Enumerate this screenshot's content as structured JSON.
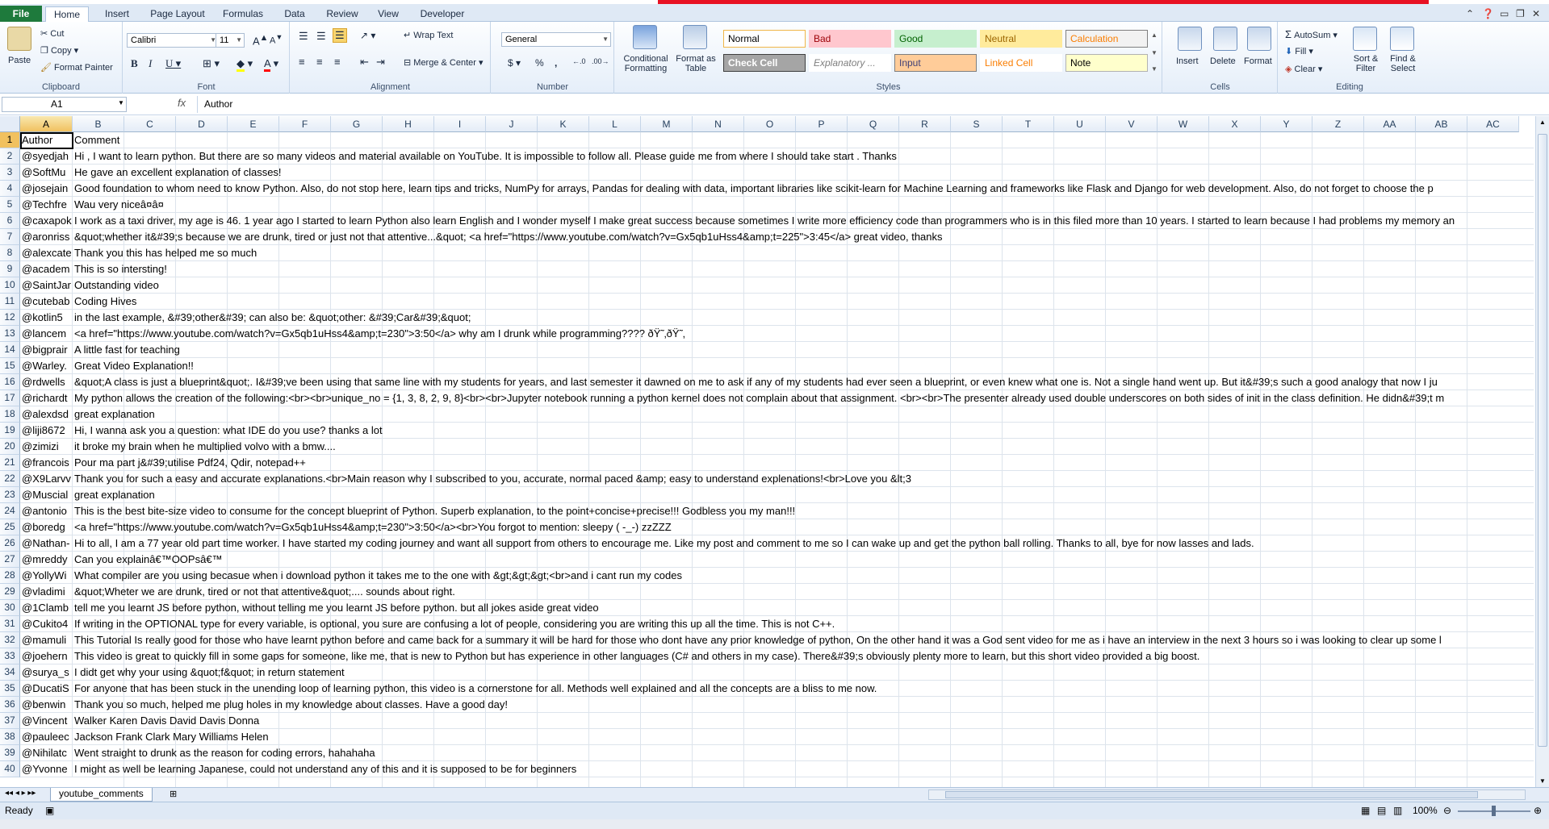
{
  "tabs": [
    "File",
    "Home",
    "Insert",
    "Page Layout",
    "Formulas",
    "Data",
    "Review",
    "View",
    "Developer"
  ],
  "ribbon": {
    "clipboard": {
      "paste": "Paste",
      "cut": "Cut",
      "copy": "Copy",
      "format_painter": "Format Painter",
      "label": "Clipboard"
    },
    "font": {
      "name": "Calibri",
      "size": "11",
      "label": "Font"
    },
    "alignment": {
      "wrap_text": "Wrap Text",
      "merge_center": "Merge & Center",
      "label": "Alignment"
    },
    "number": {
      "format": "General",
      "label": "Number"
    },
    "styles": {
      "conditional": "Conditional Formatting",
      "format_table": "Format as Table",
      "cells": [
        {
          "label": "Normal",
          "bg": "#ffffff",
          "color": "#000000",
          "border": "#f0b648"
        },
        {
          "label": "Bad",
          "bg": "#ffc7ce",
          "color": "#9c0006",
          "border": "#ffc7ce"
        },
        {
          "label": "Good",
          "bg": "#c6efce",
          "color": "#006100",
          "border": "#c6efce"
        },
        {
          "label": "Neutral",
          "bg": "#ffeb9c",
          "color": "#9c6500",
          "border": "#ffeb9c"
        },
        {
          "label": "Calculation",
          "bg": "#f2f2f2",
          "color": "#fa7d00",
          "border": "#7f7f7f"
        },
        {
          "label": "Check Cell",
          "bg": "#a5a5a5",
          "color": "#ffffff",
          "border": "#3f3f3f"
        },
        {
          "label": "Explanatory ...",
          "bg": "#ffffff",
          "color": "#7f7f7f",
          "border": "#ffffff"
        },
        {
          "label": "Input",
          "bg": "#ffcc99",
          "color": "#3f3f76",
          "border": "#7f7f7f"
        },
        {
          "label": "Linked Cell",
          "bg": "#ffffff",
          "color": "#fa7d00",
          "border": "#ffffff"
        },
        {
          "label": "Note",
          "bg": "#ffffcc",
          "color": "#000000",
          "border": "#b2b2b2"
        }
      ],
      "label": "Styles"
    },
    "cells": {
      "insert": "Insert",
      "delete": "Delete",
      "format": "Format",
      "label": "Cells"
    },
    "editing": {
      "autosum": "AutoSum",
      "fill": "Fill",
      "clear": "Clear",
      "sort_filter": "Sort & Filter",
      "find_select": "Find & Select",
      "label": "Editing"
    }
  },
  "formula_bar": {
    "name_box": "A1",
    "fx": "fx",
    "value": "Author"
  },
  "columns": [
    "A",
    "B",
    "C",
    "D",
    "E",
    "F",
    "G",
    "H",
    "I",
    "J",
    "K",
    "L",
    "M",
    "N",
    "O",
    "P",
    "Q",
    "R",
    "S",
    "T",
    "U",
    "V",
    "W",
    "X",
    "Y",
    "Z",
    "AA",
    "AB",
    "AC"
  ],
  "rows": [
    {
      "n": "1",
      "a": "Author",
      "b": "Comment"
    },
    {
      "n": "2",
      "a": "@syedjah",
      "b": "Hi , I want to learn python. But there are so many videos and material available on YouTube. It is impossible to follow all. Please guide me from where I should take start . Thanks"
    },
    {
      "n": "3",
      "a": "@SoftMu",
      "b": "He gave an excellent explanation of classes!"
    },
    {
      "n": "4",
      "a": "@josejain",
      "b": "Good foundation to whom need to know Python. Also, do not stop here, learn tips and tricks, NumPy for arrays, Pandas for dealing with data, important libraries like scikit-learn for Machine Learning and frameworks like Flask and Django for web development. Also, do not forget to choose the p"
    },
    {
      "n": "5",
      "a": "@Techfre",
      "b": "Wau very niceâ¤â¤"
    },
    {
      "n": "6",
      "a": "@caxapok",
      "b": "I work as a taxi driver, my age is 46. 1 year ago I started to learn Python also learn English and I wonder myself I make great success because sometimes I write more efficiency code than programmers who is in this filed more than 10 years. I started to learn because I had problems my memory an"
    },
    {
      "n": "7",
      "a": "@aronriss",
      "b": "&quot;whether it&#39;s because we are drunk, tired or just not that attentive...&quot; <a href=\"https://www.youtube.com/watch?v=Gx5qb1uHss4&amp;t=225\">3:45</a> great video, thanks"
    },
    {
      "n": "8",
      "a": "@alexcate",
      "b": "Thank you this has helped me so much"
    },
    {
      "n": "9",
      "a": "@academ",
      "b": "This is so intersting!"
    },
    {
      "n": "10",
      "a": "@SaintJar",
      "b": "Outstanding video"
    },
    {
      "n": "11",
      "a": "@cutebab",
      "b": "Coding Hives"
    },
    {
      "n": "12",
      "a": "@kotlin5",
      "b": "in the last example, &#39;other&#39; can also be: &quot;other: &#39;Car&#39;&quot;"
    },
    {
      "n": "13",
      "a": "@lancem",
      "b": "<a href=\"https://www.youtube.com/watch?v=Gx5qb1uHss4&amp;t=230\">3:50</a> why am I drunk while programming???? ðŸ˜‚ðŸ˜‚"
    },
    {
      "n": "14",
      "a": "@bigprair",
      "b": "A little fast for teaching"
    },
    {
      "n": "15",
      "a": "@Warley.",
      "b": "Great Video Explanation!!"
    },
    {
      "n": "16",
      "a": "@rdwells",
      "b": "&quot;A class is just a blueprint&quot;.  I&#39;ve been using that same line with my students for years, and last semester it dawned on me to ask if any of my students had ever seen a blueprint, or even knew what one is.  Not a single hand went up.  But it&#39;s such a good analogy that now I ju"
    },
    {
      "n": "17",
      "a": "@richardt",
      "b": "My python allows the creation of the following:<br><br>unique_no = {1, 3, 8, 2, 9, 8}<br><br>Jupyter notebook running a python kernel does not complain about that assignment. <br><br>The presenter already used double underscores on both sides of init in the class definition.  He didn&#39;t m"
    },
    {
      "n": "18",
      "a": "@alexdsd",
      "b": "great explanation"
    },
    {
      "n": "19",
      "a": "@liji8672",
      "b": "Hi, I wanna ask you a question: what IDE do you use? thanks a lot"
    },
    {
      "n": "20",
      "a": "@zimizi",
      "b": "it broke my brain when he multiplied volvo with a bmw...."
    },
    {
      "n": "21",
      "a": "@francois",
      "b": "Pour ma part j&#39;utilise Pdf24, Qdir, notepad++"
    },
    {
      "n": "22",
      "a": "@X9Larvv",
      "b": "Thank you for such a easy and accurate explanations.<br>Main reason why I subscribed to you, accurate, normal paced &amp; easy to understand explenations!<br>Love you &lt;3"
    },
    {
      "n": "23",
      "a": "@Muscial",
      "b": "great explanation"
    },
    {
      "n": "24",
      "a": "@antonio",
      "b": "This is the best bite-size video to consume for the concept blueprint of Python. Superb explanation, to the point+concise+precise!!! Godbless you my man!!!"
    },
    {
      "n": "25",
      "a": "@boredg",
      "b": "<a href=\"https://www.youtube.com/watch?v=Gx5qb1uHss4&amp;t=230\">3:50</a><br>You forgot to mention: sleepy ( -_-) zzZZZ"
    },
    {
      "n": "26",
      "a": "@Nathan-",
      "b": "Hi to all, I am a 77 year old part time worker. I have started my coding journey and want all support from others to encourage me. Like my post and comment to me so I can wake up and get the python ball rolling. Thanks to all, bye for now lasses and lads."
    },
    {
      "n": "27",
      "a": "@mreddy",
      "b": "Can you explainâ€™OOPsâ€™"
    },
    {
      "n": "28",
      "a": "@YollyWi",
      "b": "What compiler are you using becasue when i download python it takes me to the one with &gt;&gt;&gt;<br>and i cant run my codes"
    },
    {
      "n": "29",
      "a": "@vladimi",
      "b": "&quot;Wheter we are drunk, tired or not that attentive&quot;.... sounds about right."
    },
    {
      "n": "30",
      "a": "@1Clamb",
      "b": "tell me you learnt JS before python, without telling me you learnt JS before python. but all jokes aside great video"
    },
    {
      "n": "31",
      "a": "@Cukito4",
      "b": "If writing in the OPTIONAL type for every variable, is optional, you sure are confusing a lot of people, considering you are writing this up all the time.  This is not C++."
    },
    {
      "n": "32",
      "a": "@mamuli",
      "b": "This Tutorial Is really good for those who have learnt python before and came back for a summary it will be hard for those who dont have any prior knowledge of python, On the other hand it was a God sent video for me as i have an interview in the next 3 hours so i was looking to clear up some l"
    },
    {
      "n": "33",
      "a": "@joehern",
      "b": "This video is great to quickly fill in some gaps for someone, like me, that is new to Python but has experience in other languages (C# and others in my case). There&#39;s obviously plenty more to learn, but this short video provided a big boost."
    },
    {
      "n": "34",
      "a": "@surya_s",
      "b": "I didt get why your using &quot;f&quot; in return statement"
    },
    {
      "n": "35",
      "a": "@DucatiS",
      "b": "For anyone that has been stuck in the unending loop of learning python, this video is a cornerstone for all. Methods well explained and all the concepts are a bliss to me now."
    },
    {
      "n": "36",
      "a": "@benwin",
      "b": "Thank you so much, helped me plug holes in my knowledge about classes. Have a good day!"
    },
    {
      "n": "37",
      "a": "@Vincent",
      "b": "Walker Karen Davis David Davis Donna"
    },
    {
      "n": "38",
      "a": "@pauleec",
      "b": "Jackson Frank Clark Mary Williams Helen"
    },
    {
      "n": "39",
      "a": "@Nihilatc",
      "b": "Went straight to drunk as the reason for coding errors, hahahaha"
    },
    {
      "n": "40",
      "a": "@Yvonne",
      "b": "I might as well be learning Japanese, could not understand any of this and it is supposed to be for beginners"
    }
  ],
  "sheet_tab": "youtube_comments",
  "status": {
    "ready": "Ready",
    "zoom": "100%"
  }
}
